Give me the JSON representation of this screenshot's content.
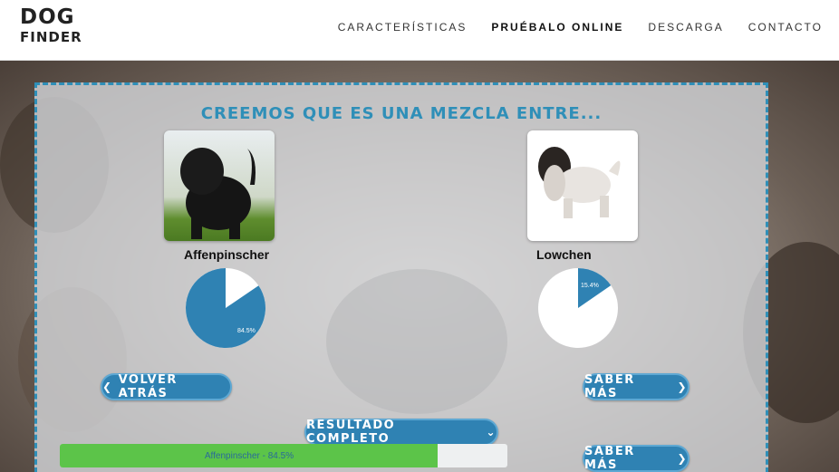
{
  "header": {
    "logo_line1": "DOG",
    "logo_line2": "FINDER",
    "nav": [
      {
        "label": "CARACTERÍSTICAS"
      },
      {
        "label": "PRUÉBALO ONLINE"
      },
      {
        "label": "DESCARGA"
      },
      {
        "label": "CONTACTO"
      }
    ]
  },
  "result": {
    "title": "CREEMOS QUE ES UNA MEZCLA ENTRE...",
    "breeds": [
      {
        "name": "Affenpinscher",
        "percent": 84.5,
        "percent_label": "84.5%"
      },
      {
        "name": "Lowchen",
        "percent": 15.4,
        "percent_label": "15.4%"
      }
    ],
    "back_button": "VOLVER ATRÁS",
    "more_button": "SABER MÁS",
    "more_button_2": "SABER MÁS",
    "full_result_button": "RESULTADO COMPLETO",
    "progress": {
      "label": "Affenpinscher - 84.5%",
      "value": 84.5
    }
  },
  "colors": {
    "accent": "#2f82b3",
    "progress_fill": "#5cc449",
    "pie_fill": "#2f82b3"
  },
  "icons": {
    "back": "chevron-left-icon",
    "more": "chevron-right-icon",
    "full": "chevron-down-icon"
  }
}
